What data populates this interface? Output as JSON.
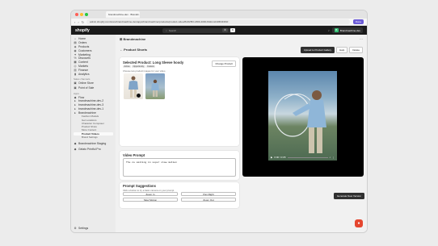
{
  "browser": {
    "tab_title": "brandmachine-dev · Brandm...",
    "url": "admin.shopify.com/store/brandmachine-dev/apps/brandmachine/products/product-video/8c4f2f50-1800-4090-8d2d-4d10f0343f40",
    "extension_label": "Done"
  },
  "shopify": {
    "logo": "shopify",
    "search_placeholder": "Search",
    "kbd1": "⌘",
    "kbd2": "K",
    "store_name": "Brandmachine-dev",
    "avatar_initial": "B"
  },
  "sidebar": {
    "items": [
      {
        "icon": "home-icon",
        "glyph": "⌂",
        "label": "Home"
      },
      {
        "icon": "orders-icon",
        "glyph": "▤",
        "label": "Orders"
      },
      {
        "icon": "products-icon",
        "glyph": "◈",
        "label": "Products"
      },
      {
        "icon": "customers-icon",
        "glyph": "◉",
        "label": "Customers"
      },
      {
        "icon": "marketing-icon",
        "glyph": "✦",
        "label": "Marketing"
      },
      {
        "icon": "discounts-icon",
        "glyph": "%",
        "label": "Discounts"
      },
      {
        "icon": "content-icon",
        "glyph": "▦",
        "label": "Content"
      },
      {
        "icon": "markets-icon",
        "glyph": "◎",
        "label": "Markets"
      },
      {
        "icon": "finance-icon",
        "glyph": "▥",
        "label": "Finance"
      },
      {
        "icon": "analytics-icon",
        "glyph": "▮",
        "label": "Analytics"
      }
    ],
    "sales_channels_header": "Sales channels",
    "online_store": "Online Store",
    "pos": "Point of Sale",
    "apps_header": "Apps",
    "flow": "Flow",
    "apps": [
      "brandmachine-dev-2",
      "brandmachine-dev-3",
      "brandmachine-dev-1",
      "Brandmachine"
    ],
    "sub_items": [
      "Fashion Models",
      "Get Locations",
      "Character Composer",
      "Product Shots",
      "More Content",
      "Product Videos",
      "Brand Settings"
    ],
    "staging": "Brandmachine Staging",
    "gelato": "Gelato Printful Pro",
    "settings": "Settings"
  },
  "main": {
    "app_title": "Brandmachine",
    "app_menu": "⋯",
    "page_title": "Product Shorts",
    "back": "←",
    "buttons": {
      "upload": "Upload to Product Gallery",
      "help": "Help",
      "delete": "Delete"
    },
    "product": {
      "heading": "Selected Product: Long Sleeve hoody",
      "badge1": "Active",
      "badge2": "Opportunity",
      "badge3": "Custom",
      "subtitle": "Choose two product images for your video",
      "change": "Change Product"
    },
    "prompt": {
      "heading": "Video Prompt",
      "value": "The co smiling in super slow motion"
    },
    "suggestions": {
      "heading": "Prompt Suggestions",
      "subtitle": "Click a button to try a basic camera on your prompt",
      "items": [
        "Zoom In",
        "Pan Right",
        "Slow Motion",
        "Zoom Out"
      ]
    },
    "video": {
      "time": "0:00 / 0:05",
      "progress": 0
    },
    "generate": "Generate New Version"
  },
  "colors": {
    "accent": "#303030",
    "brand_green": "#35c075",
    "fab": "#e5462f"
  }
}
